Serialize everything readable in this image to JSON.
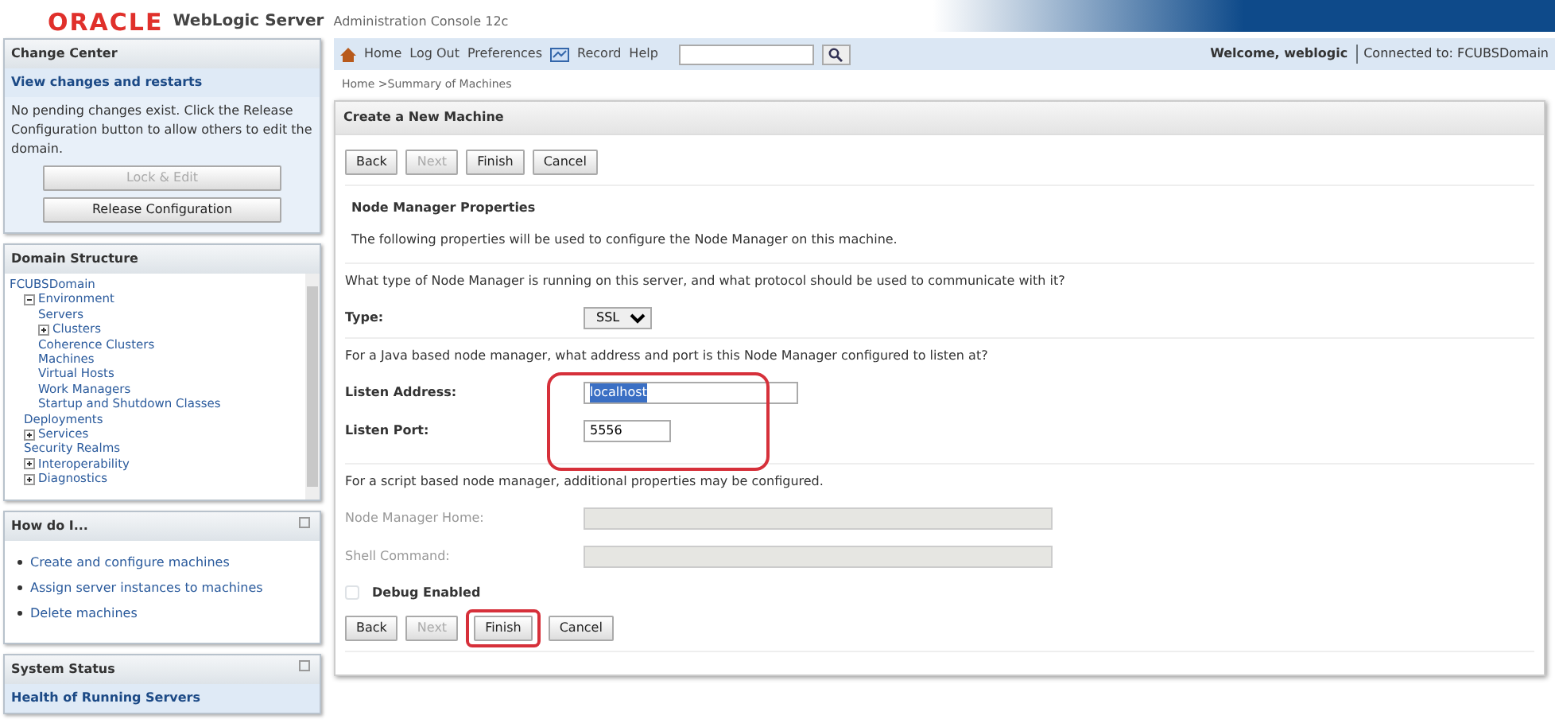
{
  "header": {
    "logo": "ORACLE",
    "product": "WebLogic Server",
    "subtitle": "Administration Console 12c"
  },
  "toolbar": {
    "links": [
      {
        "kind": "home",
        "label": "Home"
      },
      {
        "kind": "plain",
        "label": "Log Out"
      },
      {
        "kind": "plain",
        "label": "Preferences"
      },
      {
        "kind": "record",
        "label": "Record"
      },
      {
        "kind": "plain",
        "label": "Help"
      }
    ],
    "welcome": "Welcome, weblogic",
    "connected": "Connected to: FCUBSDomain"
  },
  "breadcrumb": "Home >Summary of Machines",
  "change_center": {
    "title": "Change Center",
    "link": "View changes and restarts",
    "message": "No pending changes exist. Click the Release Configuration button to allow others to edit the domain.",
    "buttons": [
      {
        "label": "Lock & Edit",
        "disabled": true
      },
      {
        "label": "Release Configuration",
        "disabled": false
      }
    ]
  },
  "domain_structure": {
    "title": "Domain Structure",
    "tree": [
      {
        "label": "FCUBSDomain",
        "children": [
          {
            "label": "Environment",
            "expanded": true,
            "children": [
              {
                "label": "Servers"
              },
              {
                "label": "Clusters",
                "expanded": false
              },
              {
                "label": "Coherence Clusters"
              },
              {
                "label": "Machines"
              },
              {
                "label": "Virtual Hosts"
              },
              {
                "label": "Work Managers"
              },
              {
                "label": "Startup and Shutdown Classes"
              }
            ]
          },
          {
            "label": "Deployments"
          },
          {
            "label": "Services",
            "expanded": false
          },
          {
            "label": "Security Realms"
          },
          {
            "label": "Interoperability",
            "expanded": false
          },
          {
            "label": "Diagnostics",
            "expanded": false
          }
        ]
      }
    ]
  },
  "how_do_i": {
    "title": "How do I...",
    "items": [
      "Create and configure machines",
      "Assign server instances to machines",
      "Delete machines"
    ]
  },
  "system_status": {
    "title": "System Status",
    "subtitle": "Health of Running Servers"
  },
  "main": {
    "title": "Create a New Machine",
    "buttons": [
      {
        "label": "Back",
        "disabled": false
      },
      {
        "label": "Next",
        "disabled": true
      },
      {
        "label": "Finish",
        "disabled": false
      },
      {
        "label": "Cancel",
        "disabled": false
      }
    ],
    "section_title": "Node Manager Properties",
    "intro": "The following properties will be used to configure the Node Manager on this machine.",
    "question1": "What type of Node Manager is running on this server, and what protocol should be used to communicate with it?",
    "type": {
      "label": "Type:",
      "value": "SSL"
    },
    "question2": "For a Java based node manager, what address and port is this Node Manager configured to listen at?",
    "listen_address": {
      "label": "Listen Address:",
      "value": "localhost"
    },
    "listen_port": {
      "label": "Listen Port:",
      "value": "5556"
    },
    "question3": "For a script based node manager, additional properties may be configured.",
    "node_manager_home": {
      "label": "Node Manager Home:",
      "disabled": true
    },
    "shell_command": {
      "label": "Shell Command:",
      "disabled": true
    },
    "debug_enabled": {
      "label": "Debug Enabled",
      "checked": false
    },
    "bottom_buttons": [
      {
        "label": "Back",
        "disabled": false
      },
      {
        "label": "Next",
        "disabled": true
      },
      {
        "label": "Finish",
        "disabled": false
      },
      {
        "label": "Cancel",
        "disabled": false
      }
    ]
  }
}
